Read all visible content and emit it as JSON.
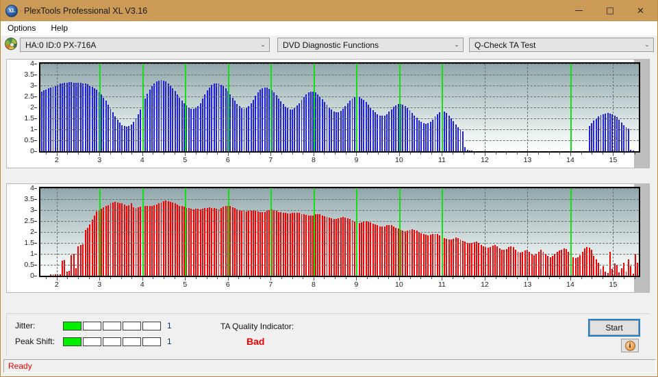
{
  "window": {
    "title": "PlexTools Professional XL V3.16",
    "app_icon": "xl-app-icon",
    "minimize_label": "—",
    "maximize_label": "□",
    "close_label": "✕"
  },
  "menu": {
    "items": [
      {
        "label": "Options"
      },
      {
        "label": "Help"
      }
    ]
  },
  "toolbar": {
    "drive_icon": "disc-icon",
    "drive": {
      "value": "HA:0 ID:0  PX-716A",
      "chevron": "⌄"
    },
    "function": {
      "value": "DVD Diagnostic Functions",
      "chevron": "⌄"
    },
    "test": {
      "value": "Q-Check TA Test",
      "chevron": "⌄"
    }
  },
  "bottom": {
    "jitter_label": "Jitter:",
    "jitter_value": "1",
    "jitter_filled": 1,
    "jitter_segments": 5,
    "peak_shift_label": "Peak Shift:",
    "peak_shift_value": "1",
    "peak_shift_filled": 1,
    "peak_shift_segments": 5,
    "ta_quality_label": "TA Quality Indicator:",
    "ta_quality_value": "Bad",
    "ta_quality_color": "#ee0000",
    "start_label": "Start",
    "info_label": "i",
    "meter_on_color": "#00f000"
  },
  "statusbar": {
    "text": "Ready",
    "color": "#ee0000"
  },
  "chart_data": [
    {
      "id": "jitter-chart",
      "type": "bar",
      "title": "",
      "xlabel": "",
      "ylabel": "",
      "color": "#2020e0",
      "ylim": [
        0,
        4
      ],
      "yticks": [
        0,
        0.5,
        1,
        1.5,
        2,
        2.5,
        3,
        3.5,
        4
      ],
      "ytick_labels": [
        "0",
        "0.5",
        "1",
        "1.5",
        "2",
        "2.5",
        "3",
        "3.5",
        "4"
      ],
      "xlim": [
        1.62,
        15.6
      ],
      "xticks": [
        2,
        3,
        4,
        5,
        6,
        7,
        8,
        9,
        10,
        11,
        12,
        13,
        14,
        15
      ],
      "xtick_labels": [
        "2",
        "3",
        "4",
        "5",
        "6",
        "7",
        "8",
        "9",
        "10",
        "11",
        "12",
        "13",
        "14",
        "15"
      ],
      "grid": true,
      "green_gridlines": [
        3,
        4,
        5,
        6,
        7,
        8,
        9,
        10,
        11,
        14
      ],
      "values": [
        2.72,
        2.78,
        2.82,
        2.86,
        2.9,
        2.95,
        3.0,
        3.04,
        3.08,
        3.1,
        3.13,
        3.14,
        3.15,
        3.15,
        3.14,
        3.13,
        3.12,
        3.11,
        3.1,
        3.08,
        3.05,
        3.0,
        2.95,
        2.88,
        2.8,
        2.7,
        2.58,
        2.45,
        2.3,
        2.12,
        1.95,
        1.78,
        1.6,
        1.45,
        1.3,
        1.2,
        1.15,
        1.12,
        1.15,
        1.22,
        1.35,
        1.5,
        1.7,
        1.92,
        2.15,
        2.4,
        2.62,
        2.82,
        2.98,
        3.1,
        3.18,
        3.22,
        3.24,
        3.22,
        3.18,
        3.1,
        3.0,
        2.88,
        2.74,
        2.6,
        2.45,
        2.3,
        2.18,
        2.08,
        2.0,
        1.95,
        1.94,
        1.96,
        2.05,
        2.2,
        2.4,
        2.6,
        2.78,
        2.92,
        3.02,
        3.08,
        3.1,
        3.08,
        3.03,
        2.96,
        2.86,
        2.74,
        2.6,
        2.45,
        2.3,
        2.16,
        2.05,
        1.98,
        1.95,
        1.98,
        2.06,
        2.18,
        2.35,
        2.52,
        2.68,
        2.8,
        2.88,
        2.92,
        2.9,
        2.85,
        2.78,
        2.68,
        2.56,
        2.42,
        2.28,
        2.15,
        2.04,
        1.96,
        1.92,
        1.92,
        1.98,
        2.08,
        2.2,
        2.35,
        2.48,
        2.6,
        2.68,
        2.72,
        2.72,
        2.68,
        2.6,
        2.5,
        2.38,
        2.25,
        2.12,
        2.0,
        1.9,
        1.82,
        1.78,
        1.78,
        1.84,
        1.94,
        2.06,
        2.2,
        2.32,
        2.42,
        2.48,
        2.5,
        2.48,
        2.42,
        2.34,
        2.24,
        2.12,
        2.0,
        1.88,
        1.78,
        1.7,
        1.64,
        1.62,
        1.64,
        1.7,
        1.8,
        1.92,
        2.02,
        2.1,
        2.15,
        2.16,
        2.13,
        2.07,
        1.98,
        1.88,
        1.76,
        1.64,
        1.52,
        1.42,
        1.34,
        1.28,
        1.26,
        1.28,
        1.34,
        1.45,
        1.58,
        1.7,
        1.78,
        1.82,
        1.8,
        1.74,
        1.64,
        1.5,
        1.36,
        1.22,
        1.1,
        1.0,
        0.92,
        0.2,
        0.05,
        0.02,
        0.01,
        0.0,
        0.0,
        0.0,
        0.0,
        0.0,
        0.0,
        0.0,
        0.0,
        0.0,
        0.0,
        0.0,
        0.0,
        0.0,
        0.0,
        0.0,
        0.0,
        0.0,
        0.0,
        0.0,
        0.0,
        0.0,
        0.0,
        0.0,
        0.0,
        0.0,
        0.0,
        0.0,
        0.0,
        0.0,
        0.0,
        0.0,
        0.0,
        0.0,
        0.0,
        0.0,
        0.0,
        0.0,
        0.0,
        0.0,
        0.0,
        0.0,
        0.0,
        0.0,
        0.0,
        0.0,
        0.0,
        0.0,
        0.0,
        0.0,
        0.0,
        1.15,
        1.28,
        1.4,
        1.5,
        1.58,
        1.65,
        1.7,
        1.73,
        1.74,
        1.73,
        1.7,
        1.64,
        1.56,
        1.45,
        1.32,
        1.2,
        1.1,
        1.02,
        0.06,
        0.02,
        0.0,
        0.0
      ]
    },
    {
      "id": "peak-shift-chart",
      "type": "bar",
      "title": "",
      "xlabel": "",
      "ylabel": "",
      "color": "#f50000",
      "ylim": [
        0,
        4
      ],
      "yticks": [
        0,
        0.5,
        1,
        1.5,
        2,
        2.5,
        3,
        3.5,
        4
      ],
      "ytick_labels": [
        "0",
        "0.5",
        "1",
        "1.5",
        "2",
        "2.5",
        "3",
        "3.5",
        "4"
      ],
      "xlim": [
        1.62,
        15.6
      ],
      "xticks": [
        2,
        3,
        4,
        5,
        6,
        7,
        8,
        9,
        10,
        11,
        12,
        13,
        14,
        15
      ],
      "xtick_labels": [
        "2",
        "3",
        "4",
        "5",
        "6",
        "7",
        "8",
        "9",
        "10",
        "11",
        "12",
        "13",
        "14",
        "15"
      ],
      "grid": true,
      "green_gridlines": [
        3,
        4,
        5,
        6,
        7,
        8,
        9,
        10,
        11,
        14
      ],
      "values": [
        0.0,
        0.0,
        0.0,
        0.0,
        0.06,
        0.07,
        0.06,
        0.07,
        0.06,
        0.7,
        0.72,
        0.2,
        0.22,
        0.95,
        1.0,
        0.35,
        1.35,
        1.4,
        1.45,
        2.1,
        2.2,
        2.35,
        2.55,
        2.75,
        2.95,
        3.0,
        3.05,
        3.12,
        3.18,
        3.22,
        3.3,
        3.35,
        3.38,
        3.34,
        3.3,
        3.3,
        3.25,
        3.2,
        3.22,
        3.3,
        3.12,
        3.1,
        3.12,
        3.15,
        3.18,
        3.2,
        3.2,
        3.18,
        3.2,
        3.22,
        3.25,
        3.3,
        3.35,
        3.4,
        3.45,
        3.42,
        3.38,
        3.34,
        3.3,
        3.25,
        3.2,
        3.18,
        3.15,
        3.1,
        3.08,
        3.05,
        3.04,
        3.06,
        3.06,
        3.04,
        3.05,
        3.08,
        3.1,
        3.12,
        3.1,
        3.08,
        3.05,
        3.04,
        3.08,
        3.15,
        3.18,
        3.2,
        3.18,
        3.12,
        3.08,
        3.04,
        3.0,
        2.98,
        2.96,
        2.95,
        2.96,
        2.98,
        3.0,
        2.98,
        2.95,
        2.92,
        2.9,
        2.92,
        2.98,
        3.0,
        3.02,
        3.0,
        2.96,
        2.92,
        2.9,
        2.88,
        2.86,
        2.85,
        2.85,
        2.86,
        2.88,
        2.88,
        2.86,
        2.82,
        2.8,
        2.78,
        2.76,
        2.74,
        2.76,
        2.8,
        2.82,
        2.8,
        2.76,
        2.72,
        2.7,
        2.66,
        2.62,
        2.6,
        2.6,
        2.62,
        2.66,
        2.68,
        2.66,
        2.62,
        2.58,
        2.52,
        2.48,
        2.44,
        2.42,
        2.44,
        2.48,
        2.5,
        2.48,
        2.44,
        2.38,
        2.34,
        2.3,
        2.26,
        2.24,
        2.26,
        2.3,
        2.32,
        2.3,
        2.26,
        2.2,
        2.15,
        2.1,
        2.06,
        2.04,
        2.06,
        2.1,
        2.12,
        2.1,
        2.06,
        2.0,
        1.95,
        1.9,
        1.86,
        1.84,
        1.86,
        1.9,
        1.92,
        1.9,
        1.84,
        1.78,
        1.72,
        1.68,
        1.65,
        1.66,
        1.7,
        1.74,
        1.72,
        1.66,
        1.6,
        1.55,
        1.5,
        1.48,
        1.5,
        1.54,
        1.56,
        1.5,
        1.42,
        1.35,
        1.3,
        1.28,
        1.32,
        1.38,
        1.4,
        1.34,
        1.26,
        1.2,
        1.18,
        1.22,
        1.3,
        1.35,
        1.3,
        1.2,
        1.1,
        1.05,
        1.08,
        1.15,
        1.2,
        1.1,
        1.0,
        0.95,
        1.0,
        1.1,
        1.18,
        1.1,
        1.0,
        0.9,
        0.85,
        0.9,
        1.0,
        1.1,
        1.15,
        1.2,
        1.25,
        1.22,
        1.1,
        0.95,
        0.85,
        0.8,
        0.85,
        0.95,
        1.1,
        1.25,
        1.3,
        1.28,
        1.2,
        0.9,
        0.75,
        0.6,
        0.3,
        0.45,
        0.2,
        0.12,
        1.1,
        0.3,
        0.55,
        0.5,
        0.15,
        0.35,
        0.6,
        0.2,
        0.75,
        0.45,
        0.1,
        1.0,
        0.6
      ]
    }
  ]
}
